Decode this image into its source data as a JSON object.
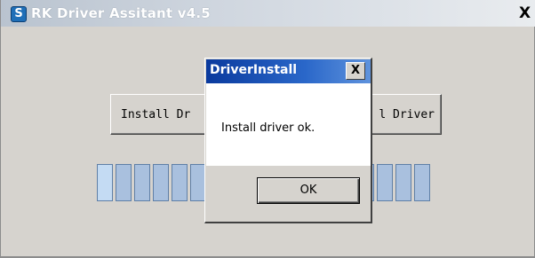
{
  "main_window": {
    "title": "RK Driver Assitant v4.5",
    "close_glyph": "X",
    "app_icon": {
      "name": "rk-app-icon",
      "glyph": "S"
    }
  },
  "buttons": {
    "install_label_visible": "Install Dr",
    "uninstall_label_visible": "l Driver"
  },
  "progress": {
    "segments_total": 18,
    "highlighted_segments": 1
  },
  "dialog": {
    "title": "DriverInstall",
    "close_glyph": "X",
    "message": "Install driver ok.",
    "ok_label": "OK"
  },
  "colors": {
    "window_face": "#d6d3ce",
    "dialog_title_start": "#0a3a9e",
    "dialog_title_end": "#5f93dd",
    "progress_segment": "#a9c0de",
    "progress_segment_border": "#5f7fa6"
  }
}
